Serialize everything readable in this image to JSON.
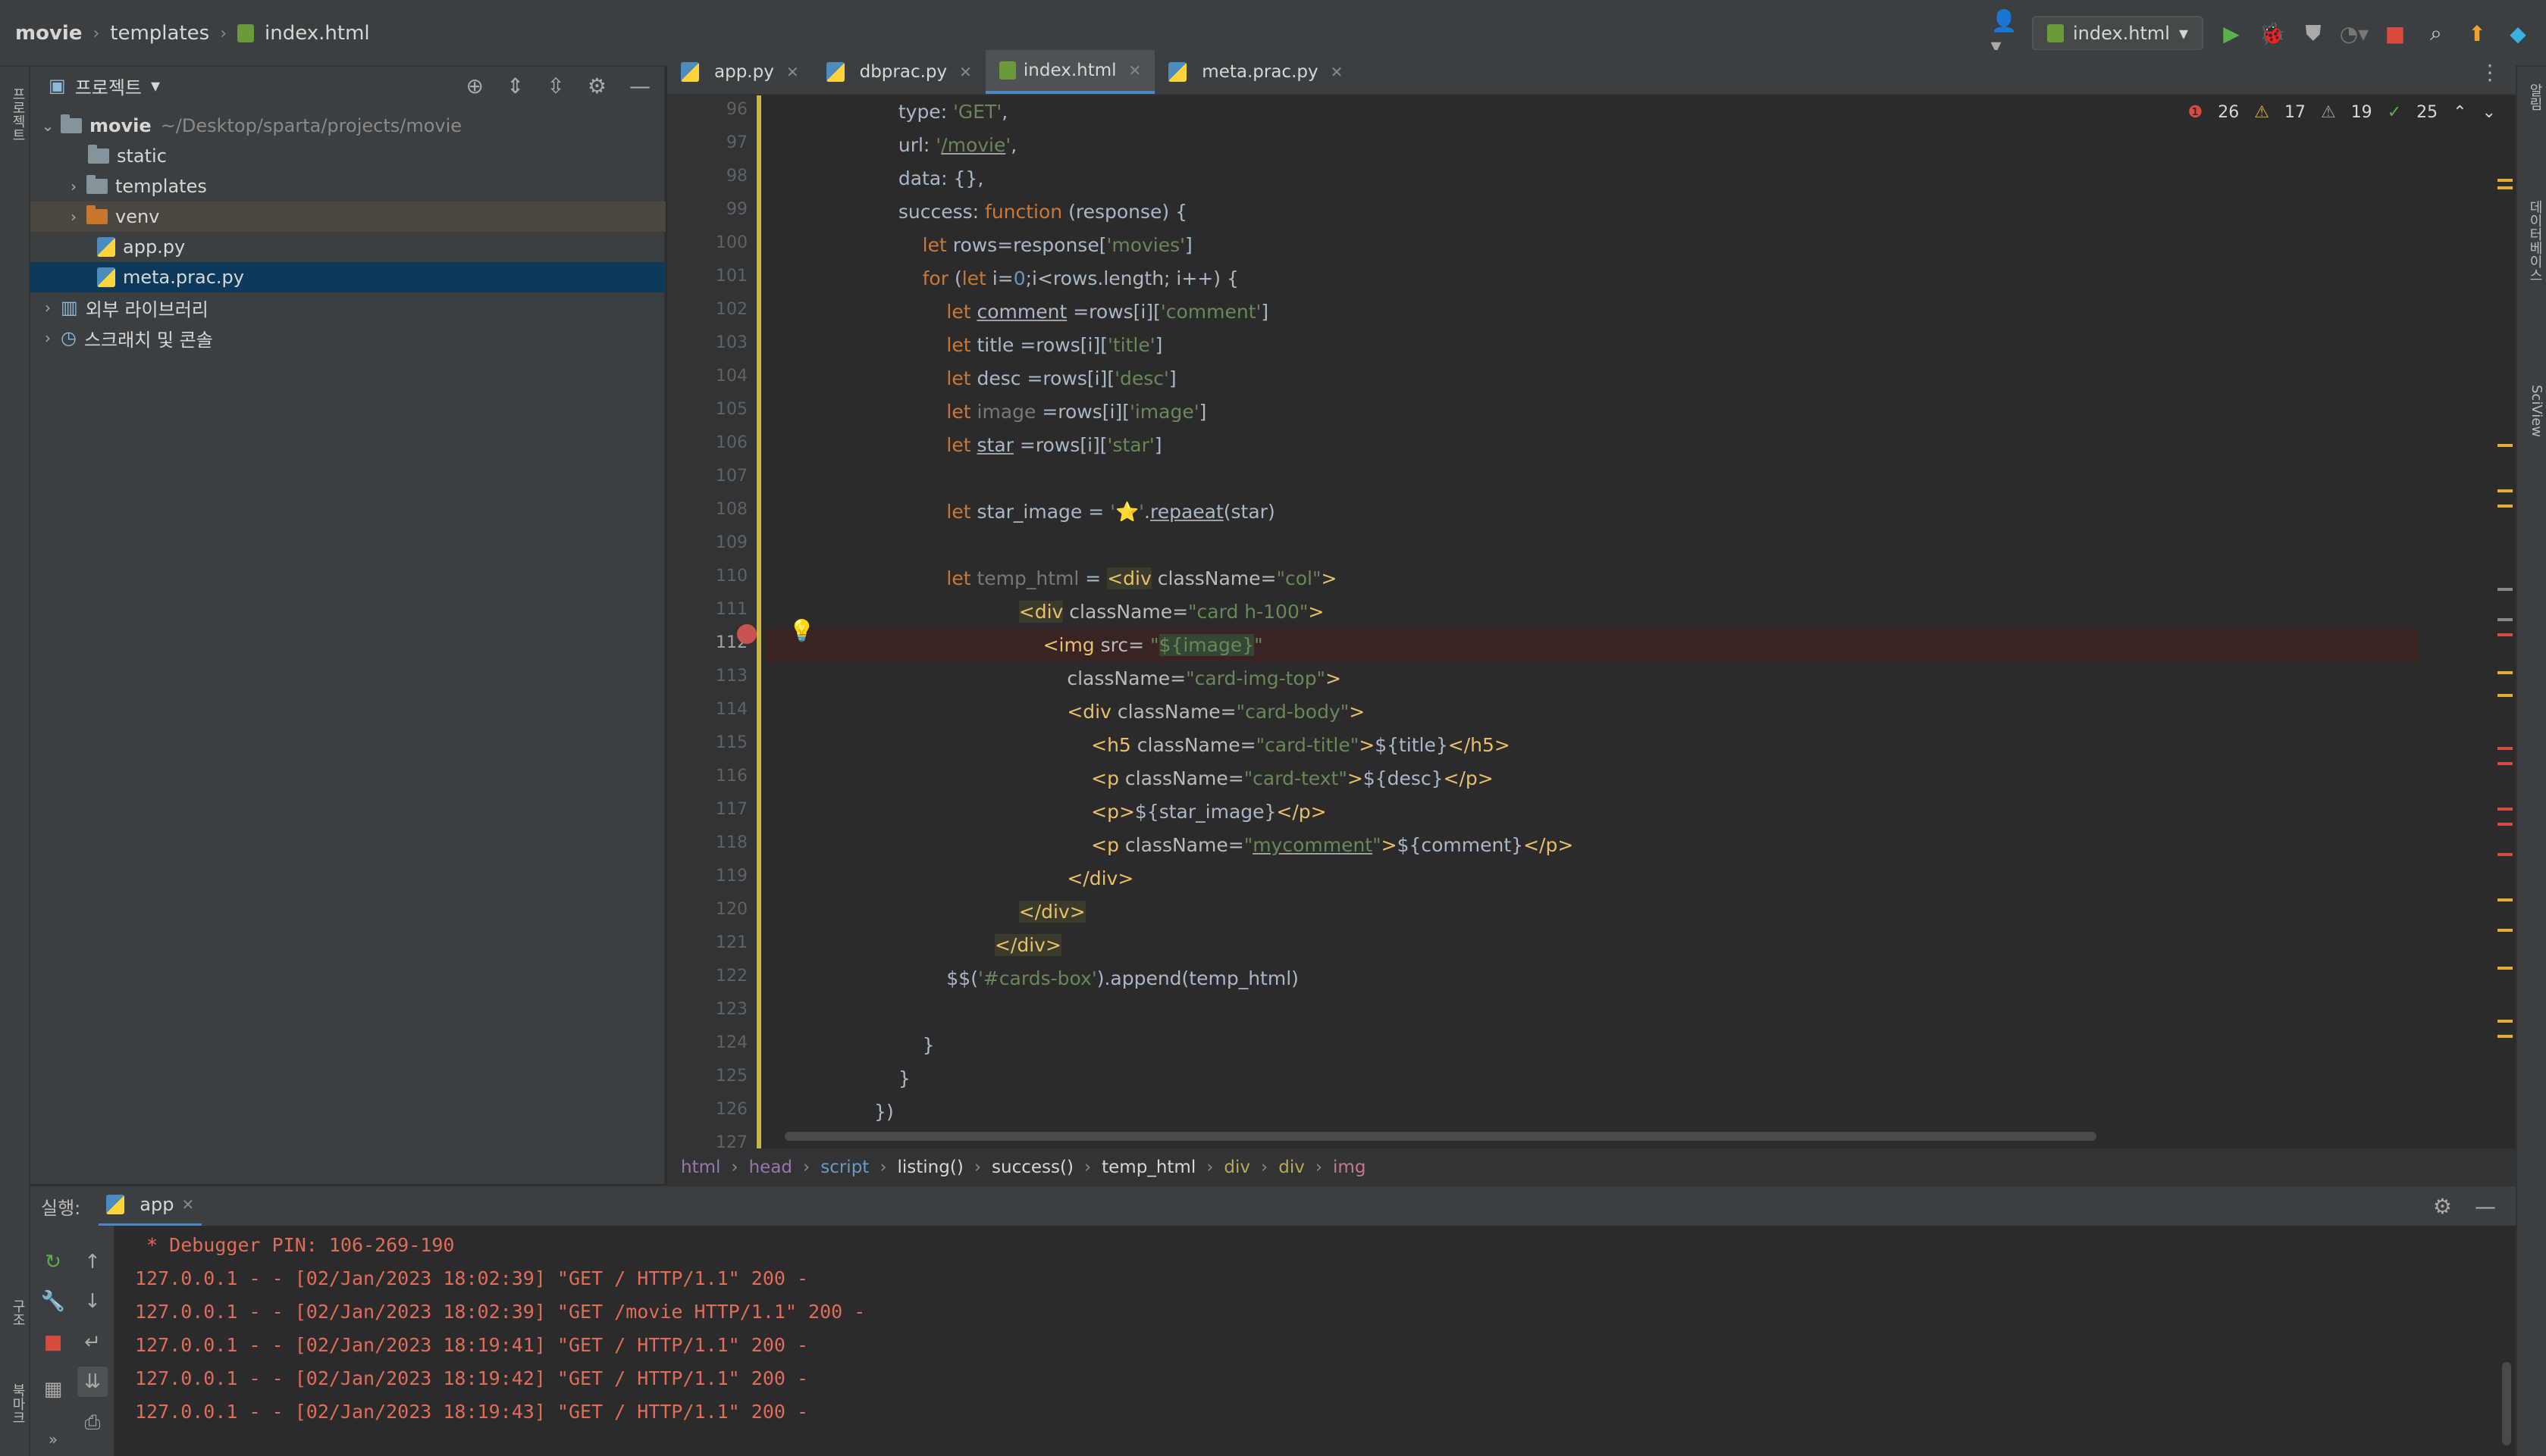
{
  "breadcrumb": {
    "project": "movie",
    "folder": "templates",
    "file": "index.html"
  },
  "run_config": {
    "label": "index.html"
  },
  "project_panel": {
    "title": "프로젝트",
    "root": {
      "name": "movie",
      "path": "~/Desktop/sparta/projects/movie"
    },
    "items": [
      {
        "name": "static",
        "type": "folder"
      },
      {
        "name": "templates",
        "type": "folder"
      },
      {
        "name": "venv",
        "type": "folder-excluded"
      },
      {
        "name": "app.py",
        "type": "python"
      },
      {
        "name": "meta.prac.py",
        "type": "python"
      }
    ],
    "external_libraries": "외부 라이브러리",
    "scratches": "스크래치 및 콘솔"
  },
  "tabs": [
    {
      "label": "app.py",
      "active": false
    },
    {
      "label": "dbprac.py",
      "active": false
    },
    {
      "label": "index.html",
      "active": true
    },
    {
      "label": "meta.prac.py",
      "active": false
    }
  ],
  "inspections": {
    "errors": "26",
    "warnings": "17",
    "weak_warnings": "19",
    "typos": "25"
  },
  "line_numbers": [
    "96",
    "97",
    "98",
    "99",
    "100",
    "101",
    "102",
    "103",
    "104",
    "105",
    "106",
    "107",
    "108",
    "109",
    "110",
    "111",
    "112",
    "113",
    "114",
    "115",
    "116",
    "117",
    "118",
    "119",
    "120",
    "121",
    "122",
    "123",
    "124",
    "125",
    "126",
    "127"
  ],
  "current_line": "112",
  "editor_breadcrumb": [
    "html",
    "head",
    "script",
    "listing()",
    "success()",
    "temp_html",
    "div",
    "div",
    "img"
  ],
  "run_panel": {
    "label": "실행:",
    "tab": "app",
    "console": [
      " * Debugger PIN: 106-269-190",
      "127.0.0.1 - - [02/Jan/2023 18:02:39] \"GET / HTTP/1.1\" 200 -",
      "127.0.0.1 - - [02/Jan/2023 18:02:39] \"GET /movie HTTP/1.1\" 200 -",
      "127.0.0.1 - - [02/Jan/2023 18:19:41] \"GET / HTTP/1.1\" 200 -",
      "127.0.0.1 - - [02/Jan/2023 18:19:42] \"GET / HTTP/1.1\" 200 -",
      "127.0.0.1 - - [02/Jan/2023 18:19:43] \"GET / HTTP/1.1\" 200 -"
    ]
  },
  "side_tabs": {
    "left_top": "프로젝트",
    "left_structure": "구조",
    "left_bookmarks": "북마크",
    "right_notifications": "알림",
    "right_database": "데이터베이스",
    "right_sciview": "SciView"
  },
  "colors": {
    "keyword": "#cc7832",
    "string": "#6a8759",
    "number": "#6897bb",
    "tag": "#e8bf6a",
    "console_text": "#e06c5a",
    "accent": "#4a88c7"
  }
}
